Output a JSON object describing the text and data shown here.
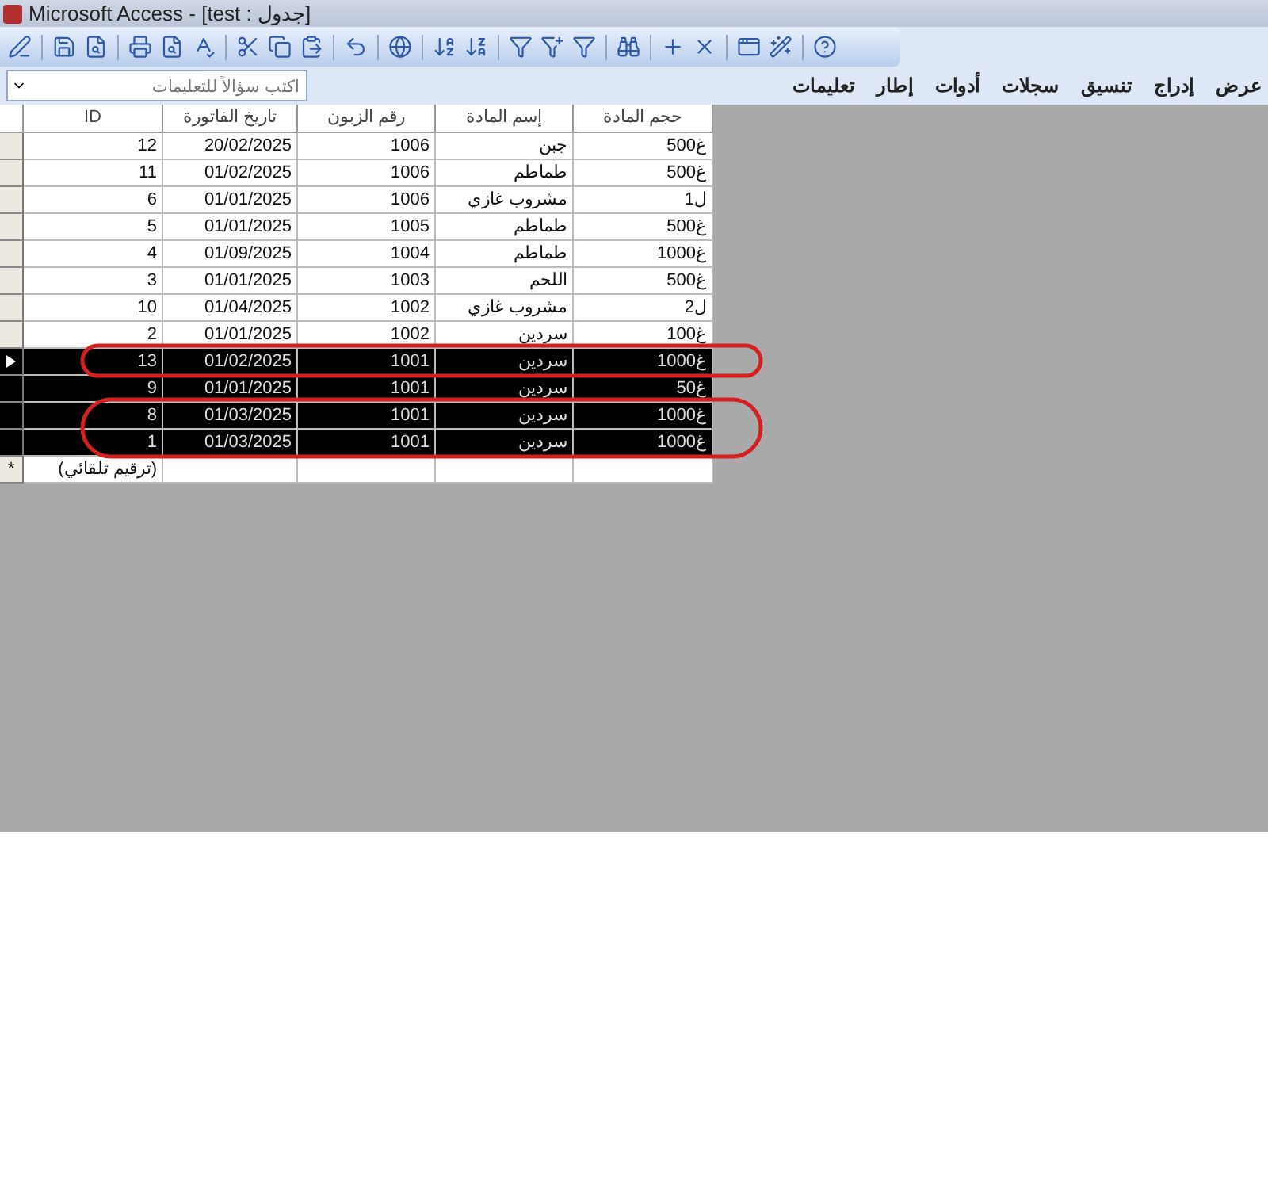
{
  "window": {
    "title": "Microsoft Access - [test : جدول]"
  },
  "menu": [
    "عرض",
    "إدراج",
    "تنسيق",
    "سجلات",
    "أدوات",
    "إطار",
    "تعليمات"
  ],
  "ask_field": {
    "placeholder": "اكتب سؤالاً للتعليمات"
  },
  "table": {
    "columns": [
      "حجم المادة",
      "إسم المادة",
      "رقم الزبون",
      "تاريخ الفاتورة",
      "ID"
    ],
    "rows": [
      {
        "cells": [
          "500غ",
          "جبن",
          "1006",
          "20/02/2025",
          "12"
        ],
        "selected": false,
        "current": false,
        "circled": false
      },
      {
        "cells": [
          "500غ",
          "طماطم",
          "1006",
          "01/02/2025",
          "11"
        ],
        "selected": false,
        "current": false,
        "circled": false
      },
      {
        "cells": [
          "1ل",
          "مشروب غازي",
          "1006",
          "01/01/2025",
          "6"
        ],
        "selected": false,
        "current": false,
        "circled": false
      },
      {
        "cells": [
          "500غ",
          "طماطم",
          "1005",
          "01/01/2025",
          "5"
        ],
        "selected": false,
        "current": false,
        "circled": false
      },
      {
        "cells": [
          "1000غ",
          "طماطم",
          "1004",
          "01/09/2025",
          "4"
        ],
        "selected": false,
        "current": false,
        "circled": false
      },
      {
        "cells": [
          "500غ",
          "اللحم",
          "1003",
          "01/01/2025",
          "3"
        ],
        "selected": false,
        "current": false,
        "circled": false
      },
      {
        "cells": [
          "2ل",
          "مشروب غازي",
          "1002",
          "01/04/2025",
          "10"
        ],
        "selected": false,
        "current": false,
        "circled": false
      },
      {
        "cells": [
          "100غ",
          "سردين",
          "1002",
          "01/01/2025",
          "2"
        ],
        "selected": false,
        "current": false,
        "circled": false
      },
      {
        "cells": [
          "1000غ",
          "سردين",
          "1001",
          "01/02/2025",
          "13"
        ],
        "selected": true,
        "current": true,
        "circled": true
      },
      {
        "cells": [
          "50غ",
          "سردين",
          "1001",
          "01/01/2025",
          "9"
        ],
        "selected": true,
        "current": false,
        "circled": false
      },
      {
        "cells": [
          "1000غ",
          "سردين",
          "1001",
          "01/03/2025",
          "8"
        ],
        "selected": true,
        "current": false,
        "circled": true
      },
      {
        "cells": [
          "1000غ",
          "سردين",
          "1001",
          "01/03/2025",
          "1"
        ],
        "selected": true,
        "current": false,
        "circled": true
      }
    ],
    "new_row": {
      "marker": "*",
      "id_placeholder": "(ترقيم تلقائي)"
    }
  }
}
